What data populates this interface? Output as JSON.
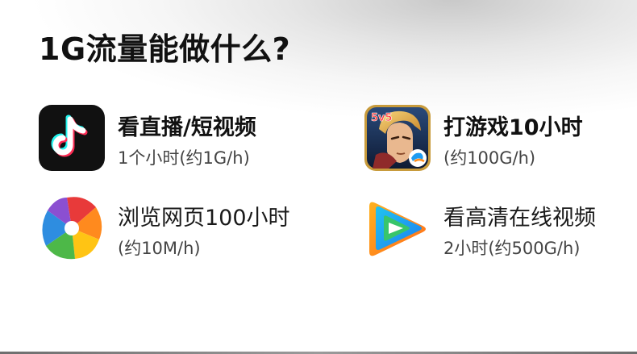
{
  "title": "1G流量能做什么?",
  "items": [
    {
      "icon": "tiktok-icon",
      "label": "看直播/短视频",
      "sub": "1个小时(约1G/h)"
    },
    {
      "icon": "honor-of-kings-icon",
      "label": "打游戏10小时",
      "sub": "(约100G/h)"
    },
    {
      "icon": "browser-icon",
      "label": "浏览网页100小时",
      "sub": "(约10M/h)"
    },
    {
      "icon": "tencent-video-icon",
      "label": "看高清在线视频",
      "sub": "2小时(约500G/h)"
    }
  ],
  "game_icon_badge": "5v5",
  "colors": {
    "title": "#111111",
    "subtext": "#444444",
    "tiktok_bg": "#111111",
    "tiktok_cyan": "#25F4EE",
    "tiktok_red": "#FE2C55",
    "tencent_green": "#38C56B",
    "tencent_blue": "#1E9BF0",
    "tencent_orange": "#FF8C1A"
  }
}
